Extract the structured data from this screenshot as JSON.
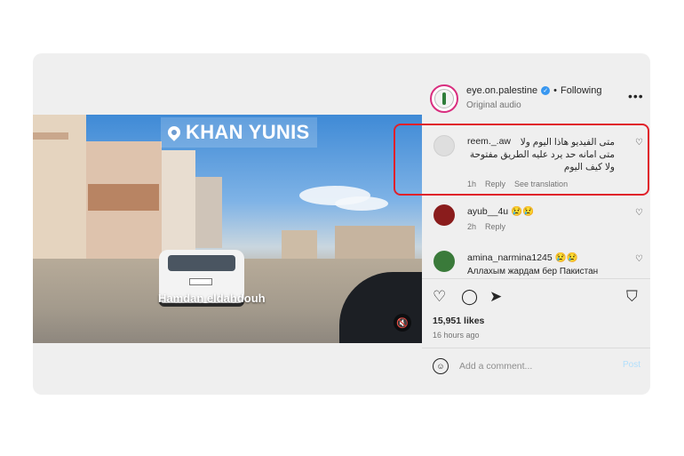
{
  "post": {
    "username": "eye.on.palestine",
    "following_label": "Following",
    "audio_label": "Original audio",
    "more_label": "•••"
  },
  "video": {
    "location_tag": "KHAN YUNIS",
    "caption": "Hamdan eldahdouh",
    "mute_icon": "🔇"
  },
  "comments": [
    {
      "username": "reem._.aw",
      "text_line1": "متى الفيديو هاذا اليوم ولا",
      "text_line2": "متى امانه حد يرد عليه الطريق مفتوحة",
      "text_line3": "ولا كيف اليوم",
      "time": "1h",
      "reply": "Reply",
      "translate": "See translation",
      "avatar_color": "#d8d8d8"
    },
    {
      "username": "ayub__4u",
      "emojis": "😢😢",
      "time": "2h",
      "reply": "Reply",
      "avatar_color": "#8a1c1c"
    },
    {
      "username": "amina_narmina1245",
      "emojis": "😢😢",
      "text_partial": "Аллахым жардам бер Пакистан",
      "avatar_color": "#3a7a3a"
    }
  ],
  "actions": {
    "like_icon": "♡",
    "comment_icon": "◯",
    "share_icon": "➤",
    "save_icon": "⛉",
    "likes": "15,951 likes",
    "time_ago": "16 hours ago"
  },
  "add_comment": {
    "emoji_icon": "☺",
    "placeholder": "Add a comment...",
    "post_label": "Post"
  },
  "colors": {
    "highlight": "#e0202a",
    "verified": "#3897f0",
    "link_disabled": "#b2dffc"
  }
}
